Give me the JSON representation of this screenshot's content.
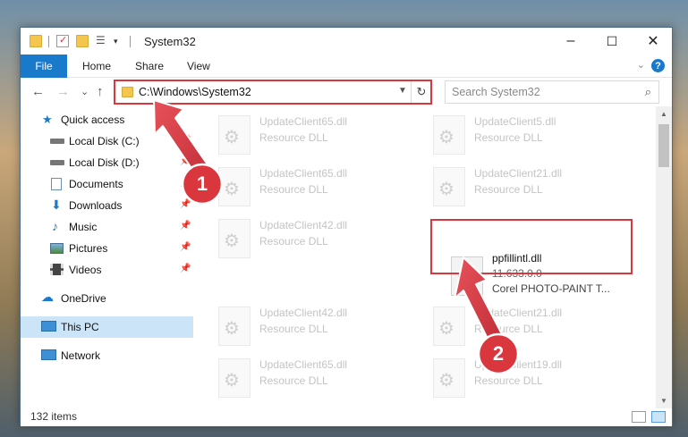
{
  "window": {
    "title": "System32",
    "controls": {
      "minimize": "–",
      "maximize": "☐",
      "close": "✕"
    }
  },
  "ribbon": {
    "file_label": "File",
    "tabs": [
      "Home",
      "Share",
      "View"
    ],
    "help": "?",
    "expand": "⌄"
  },
  "address": {
    "path": "C:\\Windows\\System32",
    "search_placeholder": "Search System32"
  },
  "nav": {
    "back": "←",
    "forward": "→",
    "recent": "⌄",
    "up": "↑"
  },
  "sidebar": {
    "items": [
      {
        "label": "Quick access",
        "icon": "star-icon",
        "pinned": false
      },
      {
        "label": "Local Disk (C:)",
        "icon": "drive-icon",
        "pinned": true
      },
      {
        "label": "Local Disk (D:)",
        "icon": "drive-icon",
        "pinned": true
      },
      {
        "label": "Documents",
        "icon": "documents-icon",
        "pinned": true
      },
      {
        "label": "Downloads",
        "icon": "download-icon",
        "pinned": true
      },
      {
        "label": "Music",
        "icon": "music-icon",
        "pinned": true
      },
      {
        "label": "Pictures",
        "icon": "pictures-icon",
        "pinned": true
      },
      {
        "label": "Videos",
        "icon": "video-icon",
        "pinned": true
      },
      {
        "label": "OneDrive",
        "icon": "cloud-icon",
        "pinned": false
      },
      {
        "label": "This PC",
        "icon": "computer-icon",
        "pinned": false
      },
      {
        "label": "Network",
        "icon": "network-icon",
        "pinned": false
      }
    ]
  },
  "files": [
    {
      "name": "UpdateClient65.dll",
      "desc": "Resource DLL",
      "faded": true
    },
    {
      "name": "UpdateClient5.dll",
      "desc": "Resource DLL",
      "faded": true
    },
    {
      "name": "UpdateClient65.dll",
      "desc": "Resource DLL",
      "faded": true
    },
    {
      "name": "UpdateClient21.dll",
      "desc": "Resource DLL",
      "faded": true
    },
    {
      "name": "UpdateClient42.dll",
      "desc": "Resource DLL",
      "faded": true
    },
    {
      "name": "ppfillintl.dll",
      "desc": "11.633.0.0",
      "desc2": "Corel PHOTO-PAINT T...",
      "faded": false
    },
    {
      "name": "UpdateClient42.dll",
      "desc": "Resource DLL",
      "faded": true
    },
    {
      "name": "UpdateClient21.dll",
      "desc": "Resource DLL",
      "faded": true
    },
    {
      "name": "UpdateClient65.dll",
      "desc": "Resource DLL",
      "faded": true
    },
    {
      "name": "UpdateClient19.dll",
      "desc": "Resource DLL",
      "faded": true
    }
  ],
  "status": {
    "items_count": "132 items"
  },
  "annotations": {
    "step1": "1",
    "step2": "2",
    "highlight_color": "#d9363e"
  },
  "colors": {
    "accent": "#1979ca",
    "selection": "#cce4f7"
  }
}
